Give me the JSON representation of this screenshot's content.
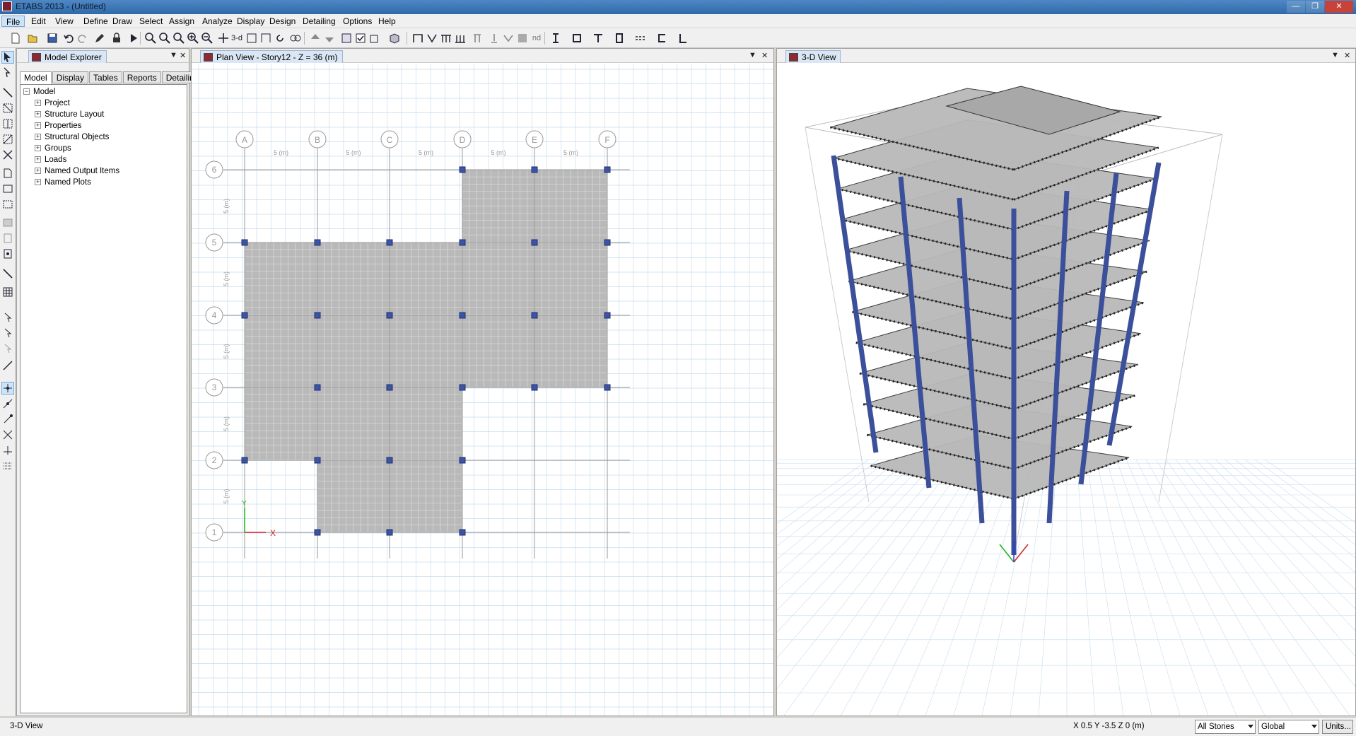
{
  "window": {
    "title": "ETABS 2013 - (Untitled)"
  },
  "menu": [
    "File",
    "Edit",
    "View",
    "Define",
    "Draw",
    "Select",
    "Assign",
    "Analyze",
    "Display",
    "Design",
    "Detailing",
    "Options",
    "Help"
  ],
  "toolbar": {
    "view3d_label": "3-d",
    "nd_label": "nd"
  },
  "explorer": {
    "title": "Model Explorer",
    "tabs": [
      "Model",
      "Display",
      "Tables",
      "Reports",
      "Detailing"
    ],
    "root": "Model",
    "items": [
      "Project",
      "Structure Layout",
      "Properties",
      "Structural Objects",
      "Groups",
      "Loads",
      "Named Output Items",
      "Named Plots"
    ]
  },
  "plan_view": {
    "title": "Plan View - Story12 - Z = 36 (m)",
    "grid_columns": [
      "A",
      "B",
      "C",
      "D",
      "E",
      "F"
    ],
    "grid_rows": [
      "1",
      "2",
      "3",
      "4",
      "5",
      "6"
    ],
    "spacing_label": "5 (m)",
    "axis_x": "X",
    "axis_y": "Y"
  },
  "view_3d": {
    "title": "3-D View"
  },
  "status": {
    "left": "3-D View",
    "coords": "X 0.5  Y -3.5  Z 0 (m)",
    "story_select": "All Stories",
    "coord_system": "Global",
    "units_button": "Units..."
  },
  "colors": {
    "column": "#3c4f9a",
    "slab": "#b9b9b9",
    "grid": "#c6ddee",
    "joint": "#3b54a8"
  }
}
